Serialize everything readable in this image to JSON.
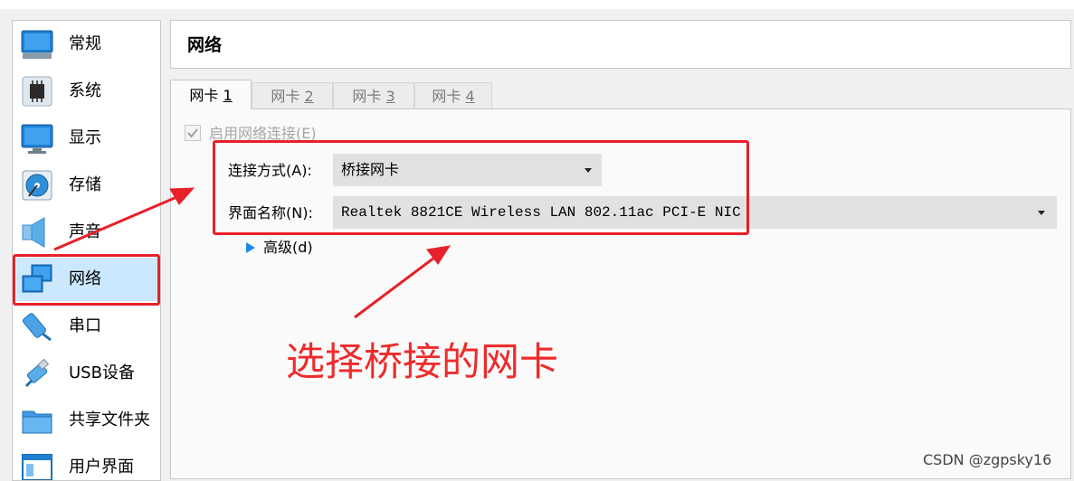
{
  "sidebar": {
    "items": [
      {
        "label": "常规",
        "icon": "display-icon"
      },
      {
        "label": "系统",
        "icon": "chip-icon"
      },
      {
        "label": "显示",
        "icon": "monitor-icon"
      },
      {
        "label": "存储",
        "icon": "disk-icon"
      },
      {
        "label": "声音",
        "icon": "speaker-icon"
      },
      {
        "label": "网络",
        "icon": "network-icon",
        "selected": true
      },
      {
        "label": "串口",
        "icon": "serial-port-icon"
      },
      {
        "label": "USB设备",
        "icon": "usb-icon"
      },
      {
        "label": "共享文件夹",
        "icon": "folder-icon"
      },
      {
        "label": "用户界面",
        "icon": "window-icon"
      }
    ]
  },
  "header": {
    "title": "网络"
  },
  "tabs": [
    {
      "label": "网卡",
      "num": "1",
      "active": true
    },
    {
      "label": "网卡",
      "num": "2"
    },
    {
      "label": "网卡",
      "num": "3"
    },
    {
      "label": "网卡",
      "num": "4"
    }
  ],
  "adapter": {
    "enable_label": "启用网络连接(E)",
    "enable_checked": true,
    "attached_label": "连接方式(A):",
    "attached_value": "桥接网卡",
    "name_label": "界面名称(N):",
    "name_value": "Realtek 8821CE Wireless LAN 802.11ac PCI-E NIC",
    "advanced_label": "高级(d)"
  },
  "annotation": {
    "text": "选择桥接的网卡",
    "color": "#ee2b2b"
  },
  "watermark": "CSDN @zgpsky16"
}
